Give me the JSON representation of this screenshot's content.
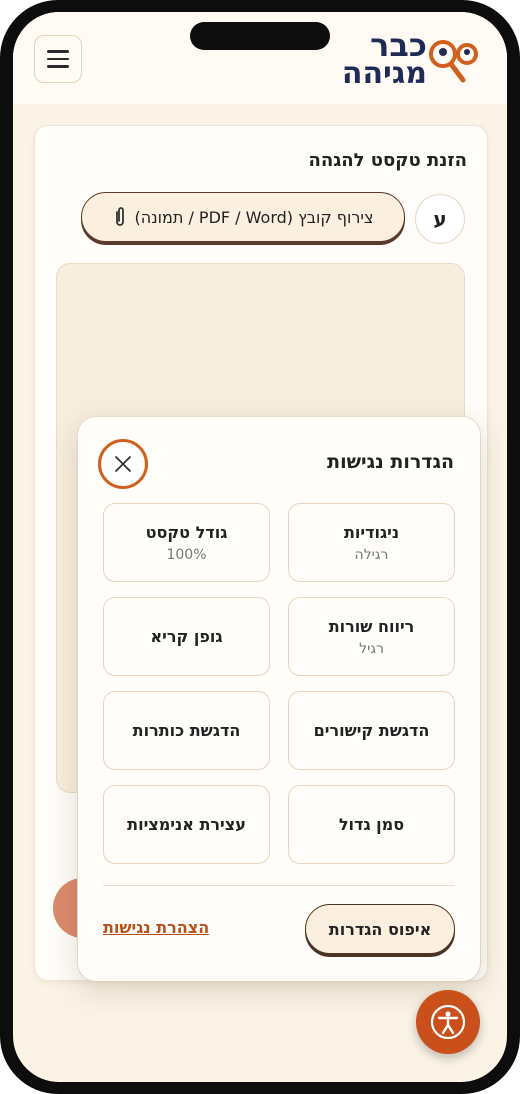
{
  "header": {
    "logo_line1": "כבר",
    "logo_line2": "מגיהה",
    "menu_icon": "hamburger-menu-icon",
    "logo_icon": "glasses-magnifier-icon"
  },
  "editor": {
    "title": "הזנת טקסט להגהה",
    "hebrew_toggle_label": "ע",
    "attach_label": "צירוף קובץ (PDF / Word / תמונה)",
    "attach_icon": "paperclip-icon"
  },
  "accessibility_panel": {
    "title": "הגדרות נגישות",
    "close_icon": "close-icon",
    "options": [
      {
        "label": "ניגודיות",
        "value": "רגילה"
      },
      {
        "label": "גודל טקסט",
        "value": "100%"
      },
      {
        "label": "ריווח שורות",
        "value": "רגיל"
      },
      {
        "label": "גופן קריא",
        "value": ""
      },
      {
        "label": "הדגשת קישורים",
        "value": ""
      },
      {
        "label": "הדגשת כותרות",
        "value": ""
      },
      {
        "label": "סמן גדול",
        "value": ""
      },
      {
        "label": "עצירת אנימציות",
        "value": ""
      }
    ],
    "reset_label": "איפוס הגדרות",
    "statement_link": "הצהרת נגישות"
  },
  "fab": {
    "icon": "accessibility-person-icon"
  },
  "colors": {
    "accent": "#c9501b",
    "navy": "#1f2b55",
    "background": "#fbf3e6"
  }
}
